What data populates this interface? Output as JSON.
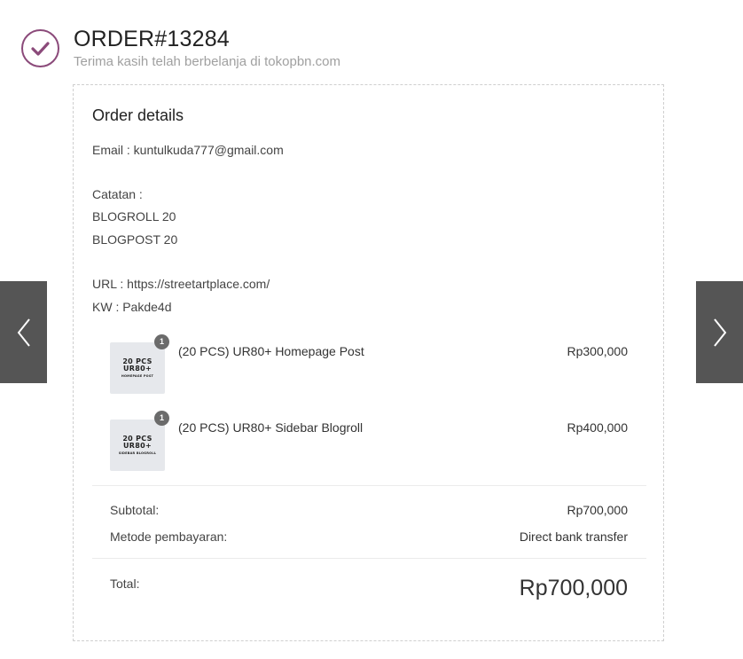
{
  "header": {
    "order_title": "ORDER#13284",
    "subtitle": "Terima kasih telah berbelanja di tokopbn.com",
    "check_icon": "check-circle-icon"
  },
  "card": {
    "title": "Order details",
    "email_line": "Email : kuntulkuda777@gmail.com",
    "notes": [
      "Catatan :",
      "BLOGROLL 20",
      "BLOGPOST 20"
    ],
    "url_line": "URL : https://streetartplace.com/",
    "kw_line": "KW : Pakde4d"
  },
  "items": [
    {
      "thumb_line1": "20 PCS",
      "thumb_line2": "UR80+",
      "thumb_line3": "HOMEPAGE POST",
      "qty": "1",
      "name": "(20 PCS) UR80+ Homepage Post",
      "price": "Rp300,000"
    },
    {
      "thumb_line1": "20 PCS",
      "thumb_line2": "UR80+",
      "thumb_line3": "SIDEBAR BLOGROLL",
      "qty": "1",
      "name": "(20 PCS) UR80+ Sidebar Blogroll",
      "price": "Rp400,000"
    }
  ],
  "summary": {
    "subtotal_label": "Subtotal:",
    "subtotal_value": "Rp700,000",
    "payment_label": "Metode pembayaran:",
    "payment_value": "Direct bank transfer",
    "total_label": "Total:",
    "total_value": "Rp700,000"
  },
  "nav": {
    "prev_icon": "chevron-left-icon",
    "next_icon": "chevron-right-icon"
  },
  "colors": {
    "accent": "#8b4a7a",
    "nav_bg": "#555555",
    "badge_bg": "#6b6b6b",
    "thumb_bg": "#e6e8ec"
  }
}
